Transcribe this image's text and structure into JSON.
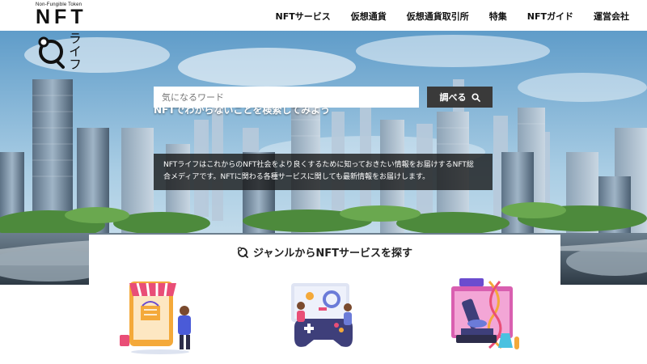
{
  "logo": {
    "tagline": "Non-Fungible Token",
    "wordmark": "NFT",
    "kana": "ライフ"
  },
  "nav": {
    "items": [
      "NFTサービス",
      "仮想通貨",
      "仮想通貨取引所",
      "特集",
      "NFTガイド",
      "運営会社"
    ]
  },
  "hero": {
    "search_title": "NFTでわからないことを検索してみよう",
    "search_placeholder": "気になるワード",
    "search_button": "調べる",
    "description_line1": "NFTライフはこれからのNFT社会をより良くするために知っておきたい情報をお届けするNFT総",
    "description_line2": "合メディアです。NFTに関わる各種サービスに関しても最新情報をお届けします。"
  },
  "genre": {
    "title": "ジャンルからNFTサービスを探す",
    "cards": [
      {
        "icon": "shopping-marketplace-icon"
      },
      {
        "icon": "gaming-icon"
      },
      {
        "icon": "science-microscope-icon"
      }
    ]
  },
  "colors": {
    "search_button_bg": "#3a3a3a",
    "description_bg": "#191919"
  }
}
